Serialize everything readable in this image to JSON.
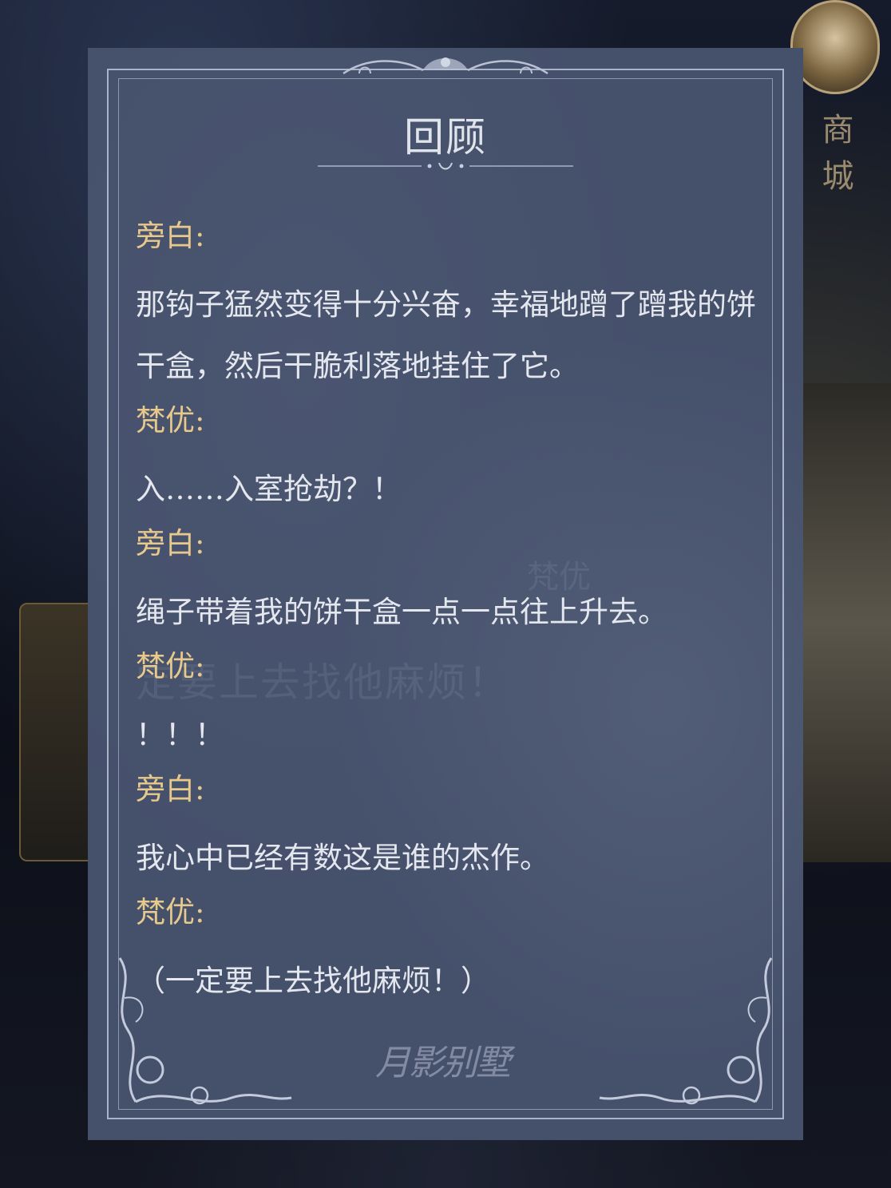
{
  "shop": {
    "label": "商城"
  },
  "review": {
    "title": "回顾",
    "entries": [
      {
        "speaker": "旁白:",
        "text": "那钩子猛然变得十分兴奋，幸福地蹭了蹭我的饼干盒，然后干脆利落地挂住了它。"
      },
      {
        "speaker": "梵优:",
        "text": "入……入室抢劫？！"
      },
      {
        "speaker": "旁白:",
        "text": "绳子带着我的饼干盒一点一点往上升去。"
      },
      {
        "speaker": "梵优:",
        "text": "！！！"
      },
      {
        "speaker": "旁白:",
        "text": "我心中已经有数这是谁的杰作。"
      },
      {
        "speaker": "梵优:",
        "text": "（一定要上去找他麻烦！）"
      }
    ]
  },
  "background": {
    "dialog_speaker": "梵优",
    "dialog_text": "定要上去找他麻烦！"
  },
  "logo": {
    "text": "月影别墅"
  },
  "colors": {
    "panel": "#45506b",
    "speaker": "#e7c98c",
    "text": "#e4e7ee",
    "frame": "#aab3c8"
  }
}
